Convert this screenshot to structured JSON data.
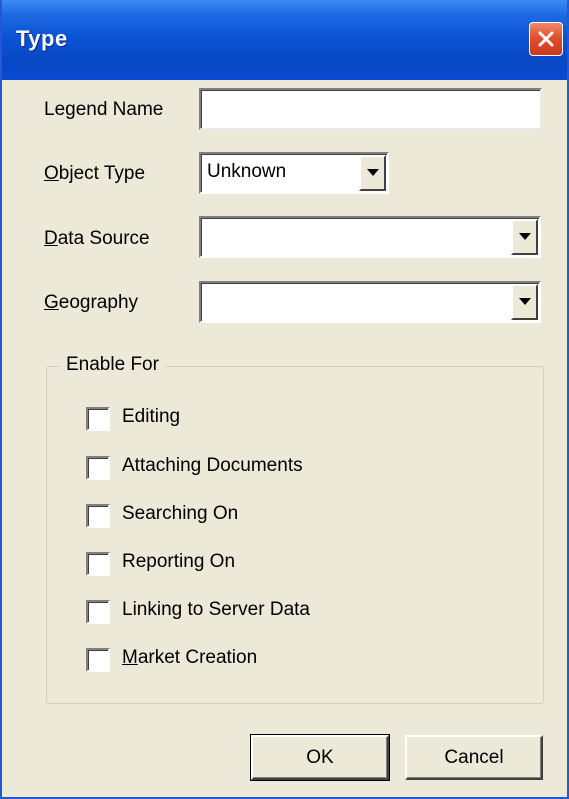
{
  "window": {
    "title": "Type"
  },
  "form": {
    "legend_name": {
      "label": "Legend Name",
      "value": ""
    },
    "object_type": {
      "label_prefix": "",
      "label_mnemonic": "O",
      "label_rest": "bject Type",
      "value": "Unknown"
    },
    "data_source": {
      "label_mnemonic": "D",
      "label_rest": "ata Source",
      "value": ""
    },
    "geography": {
      "label_mnemonic": "G",
      "label_rest": "eography",
      "value": ""
    }
  },
  "enable_for": {
    "title": "Enable For",
    "items": [
      {
        "label": "Editing",
        "checked": false
      },
      {
        "label": "Attaching Documents",
        "checked": false
      },
      {
        "label": "Searching On",
        "checked": false
      },
      {
        "label": "Reporting On",
        "checked": false
      },
      {
        "label": "Linking to Server Data",
        "checked": false
      },
      {
        "label_mnemonic": "M",
        "label_rest": "arket Creation",
        "checked": false
      }
    ]
  },
  "buttons": {
    "ok": "OK",
    "cancel": "Cancel"
  },
  "icons": {
    "close": "close-icon",
    "dropdown": "chevron-down-icon"
  },
  "colors": {
    "titlebar": "#0a54d6",
    "close": "#e0502c",
    "face": "#ece9d8"
  }
}
